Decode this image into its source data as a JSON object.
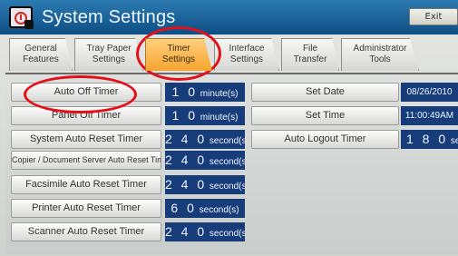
{
  "window": {
    "title": "System Settings",
    "exit_label": "Exit"
  },
  "tabs": [
    {
      "line1": "General",
      "line2": "Features",
      "active": false
    },
    {
      "line1": "Tray Paper",
      "line2": "Settings",
      "active": false
    },
    {
      "line1": "Timer",
      "line2": "Settings",
      "active": true
    },
    {
      "line1": "Interface",
      "line2": "Settings",
      "active": false
    },
    {
      "line1": "File",
      "line2": "Transfer",
      "active": false
    },
    {
      "line1": "Administrator",
      "line2": "Tools",
      "active": false
    }
  ],
  "left_settings": [
    {
      "label": "Auto Off Timer",
      "value": "1 0",
      "unit": "minute(s)"
    },
    {
      "label": "Panel Off Timer",
      "value": "1 0",
      "unit": "minute(s)"
    },
    {
      "label": "System Auto Reset Timer",
      "value": "2 4 0",
      "unit": "second(s)"
    },
    {
      "label": "Copier / Document Server Auto Reset Timer",
      "value": "2 4 0",
      "unit": "second(s)"
    },
    {
      "label": "Facsimile Auto Reset Timer",
      "value": "2 4 0",
      "unit": "second(s)"
    },
    {
      "label": "Printer Auto Reset Timer",
      "value": "6 0",
      "unit": "second(s)"
    },
    {
      "label": "Scanner Auto Reset Timer",
      "value": "2 4 0",
      "unit": "second(s)"
    }
  ],
  "right_settings": [
    {
      "label": "Set Date",
      "value": "08/26/2010",
      "unit": ""
    },
    {
      "label": "Set Time",
      "value": "11:00:49AM",
      "unit": ""
    },
    {
      "label": "Auto Logout Timer",
      "value": "1 8 0",
      "unit": "secon"
    }
  ],
  "colors": {
    "titlebar": "#0d4f85",
    "active_tab": "#f6a430",
    "value_box": "#163c79",
    "annotation": "#e3101a"
  },
  "icons": {
    "app_icon": "timer-settings-icon"
  }
}
